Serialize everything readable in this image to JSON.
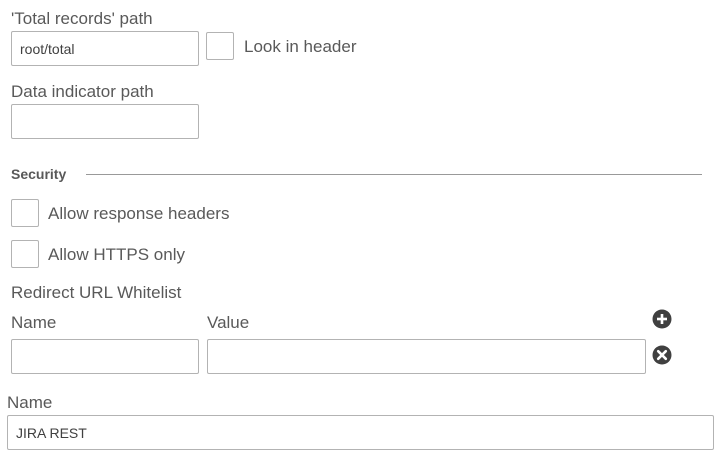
{
  "total_records": {
    "label": "'Total records' path",
    "value": "root/total",
    "look_in_header_label": "Look in header",
    "look_in_header_checked": false
  },
  "data_indicator": {
    "label": "Data indicator path",
    "value": ""
  },
  "security": {
    "title": "Security",
    "allow_response_headers_label": "Allow response headers",
    "allow_response_headers_checked": false,
    "allow_https_only_label": "Allow HTTPS only",
    "allow_https_only_checked": false
  },
  "whitelist": {
    "title": "Redirect URL Whitelist",
    "name_header": "Name",
    "value_header": "Value",
    "rows": [
      {
        "name": "",
        "value": ""
      }
    ],
    "add_icon": "plus-circle-icon",
    "remove_icon": "close-circle-icon"
  },
  "connection_name": {
    "label": "Name",
    "value": "JIRA REST"
  },
  "colors": {
    "text": "#595959",
    "border": "#b3b3b3",
    "icon": "#404040"
  }
}
